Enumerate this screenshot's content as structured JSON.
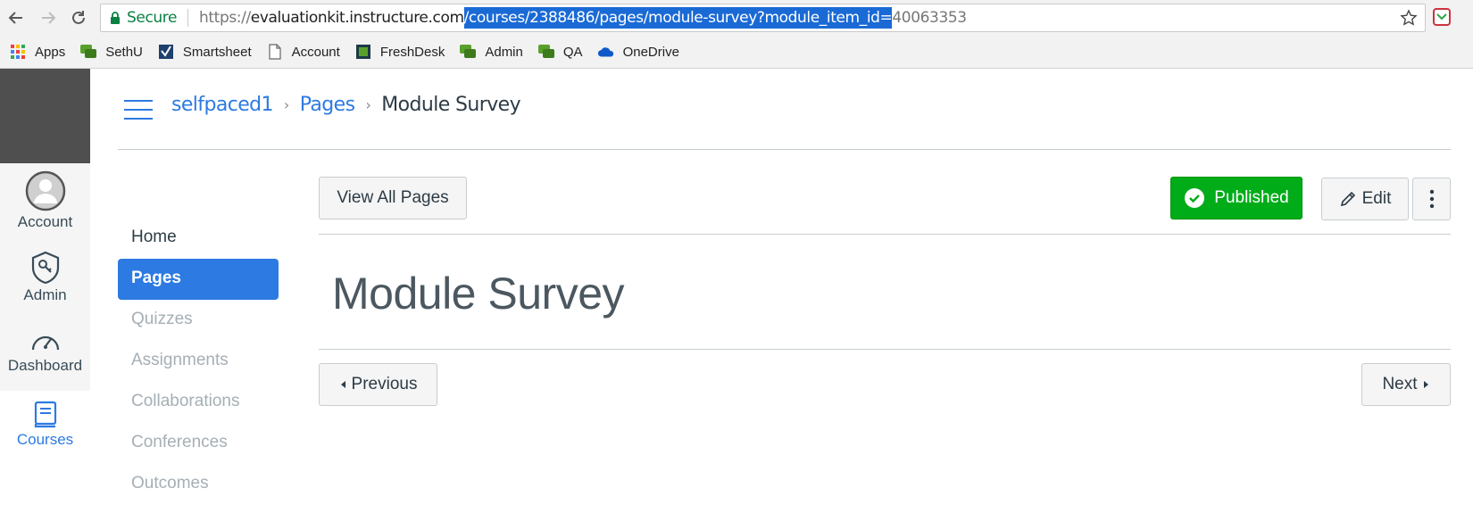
{
  "browser": {
    "secure_label": "Secure",
    "url_scheme": "https://",
    "url_host": "evaluationkit.instructure.com",
    "url_selected": "/courses/2388486/pages/module-survey?module_item_id=",
    "url_rest": "40063353"
  },
  "bookmarks": [
    {
      "label": "Apps",
      "icon": "apps-grid-icon"
    },
    {
      "label": "SethU",
      "icon": "chat-bubbles-icon"
    },
    {
      "label": "Smartsheet",
      "icon": "smartsheet-icon"
    },
    {
      "label": "Account",
      "icon": "page-icon"
    },
    {
      "label": "FreshDesk",
      "icon": "freshdesk-icon"
    },
    {
      "label": "Admin",
      "icon": "chat-bubbles-icon"
    },
    {
      "label": "QA",
      "icon": "chat-bubbles-icon"
    },
    {
      "label": "OneDrive",
      "icon": "cloud-icon"
    }
  ],
  "global_nav": {
    "account": "Account",
    "admin": "Admin",
    "dashboard": "Dashboard",
    "courses": "Courses"
  },
  "breadcrumb": {
    "course": "selfpaced1",
    "section": "Pages",
    "current": "Module Survey"
  },
  "course_nav": [
    {
      "label": "Home",
      "state": "normal"
    },
    {
      "label": "Pages",
      "state": "active"
    },
    {
      "label": "Quizzes",
      "state": "disabled"
    },
    {
      "label": "Assignments",
      "state": "disabled"
    },
    {
      "label": "Collaborations",
      "state": "disabled"
    },
    {
      "label": "Conferences",
      "state": "disabled"
    },
    {
      "label": "Outcomes",
      "state": "disabled"
    }
  ],
  "toolbar": {
    "view_all": "View All Pages",
    "published": "Published",
    "edit": "Edit"
  },
  "page": {
    "title": "Module Survey"
  },
  "footer_nav": {
    "previous": "Previous",
    "next": "Next"
  },
  "colors": {
    "accent": "#2d7ae2",
    "published": "#00ac18",
    "nav_logo_bg": "#4f4f4f"
  }
}
